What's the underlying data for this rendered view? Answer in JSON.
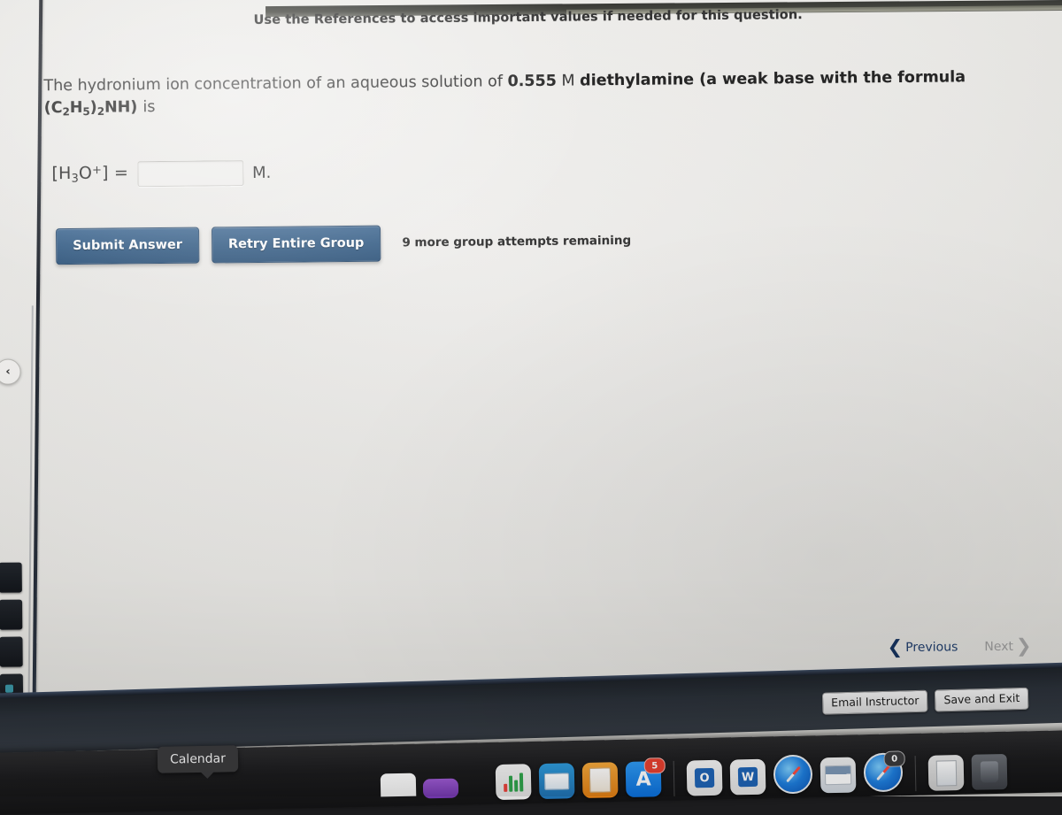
{
  "header": {
    "references_note": "Use the References to access important values if needed for this question."
  },
  "question": {
    "part1": "The hydronium ion concentration of an aqueous solution of ",
    "concentration": "0.555",
    "unit_M": " M ",
    "substance": "diethylamine",
    "part2": " (a weak base with the formula",
    "formula_prefix": "(C",
    "formula_sub1": "2",
    "formula_h": "H",
    "formula_sub2": "5",
    "formula_close": ")",
    "formula_sub3": "2",
    "formula_nh": "NH) ",
    "formula_tail": "is"
  },
  "answer": {
    "label_open": "[H",
    "label_sub": "3",
    "label_o": "O",
    "label_sup": "+",
    "label_close": "] =",
    "input_value": "",
    "input_placeholder": "",
    "unit": "M."
  },
  "buttons": {
    "submit": "Submit Answer",
    "retry": "Retry Entire Group",
    "attempts": "9 more group attempts remaining"
  },
  "nav": {
    "previous": "Previous",
    "next": "Next",
    "prev_chevron": "❮",
    "next_chevron": "❯"
  },
  "bottom_bar": {
    "email_instructor": "Email Instructor",
    "save_and_exit": "Save and Exit"
  },
  "left_edge": {
    "back_chevron": "‹"
  },
  "dock": {
    "tooltip": "Calendar",
    "items": [
      {
        "name": "numbers",
        "glyph": ""
      },
      {
        "name": "keynote",
        "glyph": ""
      },
      {
        "name": "pages",
        "glyph": ""
      },
      {
        "name": "app-store",
        "glyph": "A",
        "badge": "5"
      },
      {
        "name": "outlook",
        "glyph": "O"
      },
      {
        "name": "word",
        "glyph": "W"
      },
      {
        "name": "safari",
        "glyph": ""
      },
      {
        "name": "preview",
        "glyph": ""
      },
      {
        "name": "safari-2",
        "glyph": "",
        "badge": "0"
      },
      {
        "name": "document",
        "glyph": ""
      },
      {
        "name": "trash",
        "glyph": ""
      }
    ]
  },
  "colors": {
    "button_blue": "#305a84",
    "prev_link": "#1f3d6b",
    "next_disabled": "#9a9a9a",
    "page_bg": "#e9e8e5",
    "dock_bg": "#1b1b1d",
    "badge_red": "#e8402f"
  }
}
